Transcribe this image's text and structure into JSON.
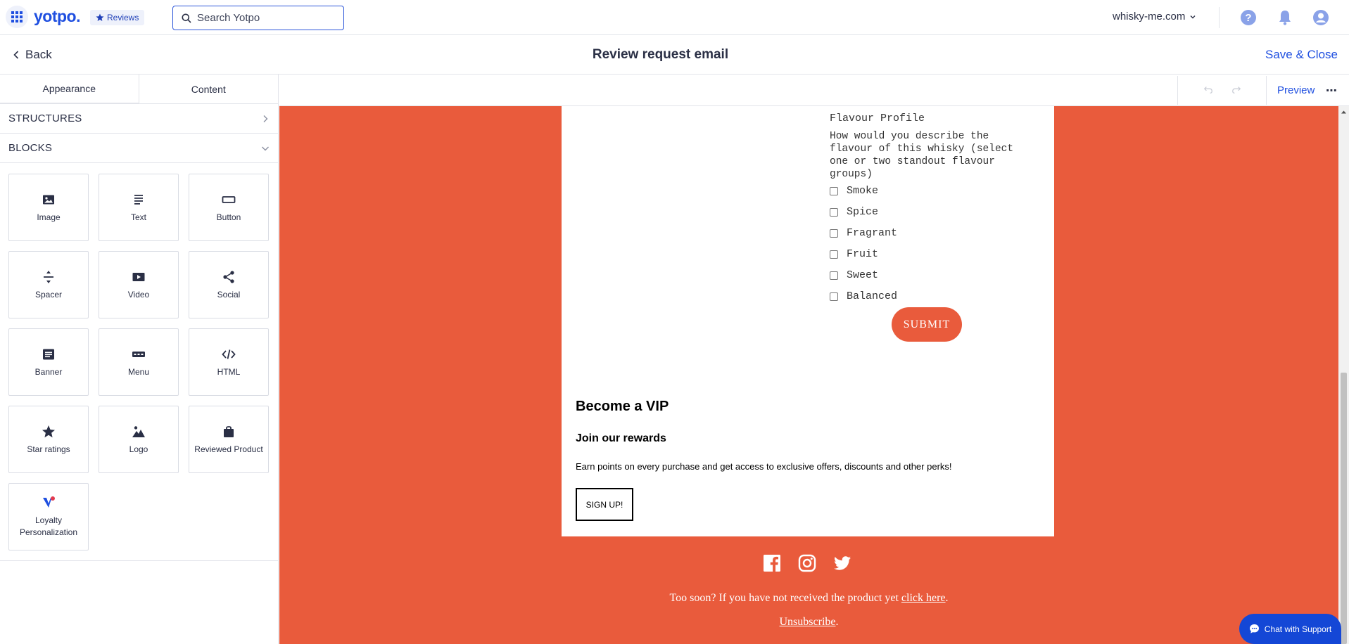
{
  "topbar": {
    "logo": "yotpo.",
    "product_badge": "Reviews",
    "search_placeholder": "Search Yotpo",
    "store": "whisky-me.com"
  },
  "subheader": {
    "back_label": "Back",
    "title": "Review request email",
    "save_close_label": "Save & Close"
  },
  "sidebar": {
    "tabs": [
      {
        "label": "Appearance",
        "active": false
      },
      {
        "label": "Content",
        "active": true
      }
    ],
    "structures_label": "STRUCTURES",
    "blocks_label": "BLOCKS",
    "blocks": [
      {
        "label": "Image",
        "icon": "image-icon"
      },
      {
        "label": "Text",
        "icon": "text-icon"
      },
      {
        "label": "Button",
        "icon": "button-icon"
      },
      {
        "label": "Spacer",
        "icon": "spacer-icon"
      },
      {
        "label": "Video",
        "icon": "video-icon"
      },
      {
        "label": "Social",
        "icon": "share-icon"
      },
      {
        "label": "Banner",
        "icon": "banner-icon"
      },
      {
        "label": "Menu",
        "icon": "menu-icon"
      },
      {
        "label": "HTML",
        "icon": "code-icon"
      },
      {
        "label": "Star ratings",
        "icon": "star-icon"
      },
      {
        "label": "Logo",
        "icon": "logo-icon"
      },
      {
        "label": "Reviewed Product",
        "icon": "shopping-bag-icon"
      },
      {
        "label": "Loyalty Personalization",
        "icon": "loyalty-icon"
      }
    ]
  },
  "toolbar": {
    "preview_label": "Preview",
    "more_label": "⋯"
  },
  "email": {
    "flavour_title": "Flavour Profile",
    "flavour_question": "How would you describe the flavour of this whisky (select one or two standout flavour groups)",
    "flavour_options": [
      "Smoke",
      "Spice",
      "Fragrant",
      "Fruit",
      "Sweet",
      "Balanced"
    ],
    "submit_label": "SUBMIT",
    "vip_title": "Become a VIP",
    "vip_subtitle": "Join our rewards",
    "vip_text": "Earn points on every purchase and get access to exclusive offers, discounts and other perks!",
    "signup_label": "SIGN UP!",
    "footer_text": "Too soon? If you have not received the product yet",
    "footer_link": "click here",
    "footer_period": ".",
    "unsubscribe_label": "Unsubscribe",
    "unsubscribe_period": "."
  },
  "chat": {
    "label": "Chat with Support"
  },
  "colors": {
    "accent": "#1f4fe0",
    "email_background": "#e95b3c",
    "chat_button": "#1447d6"
  }
}
